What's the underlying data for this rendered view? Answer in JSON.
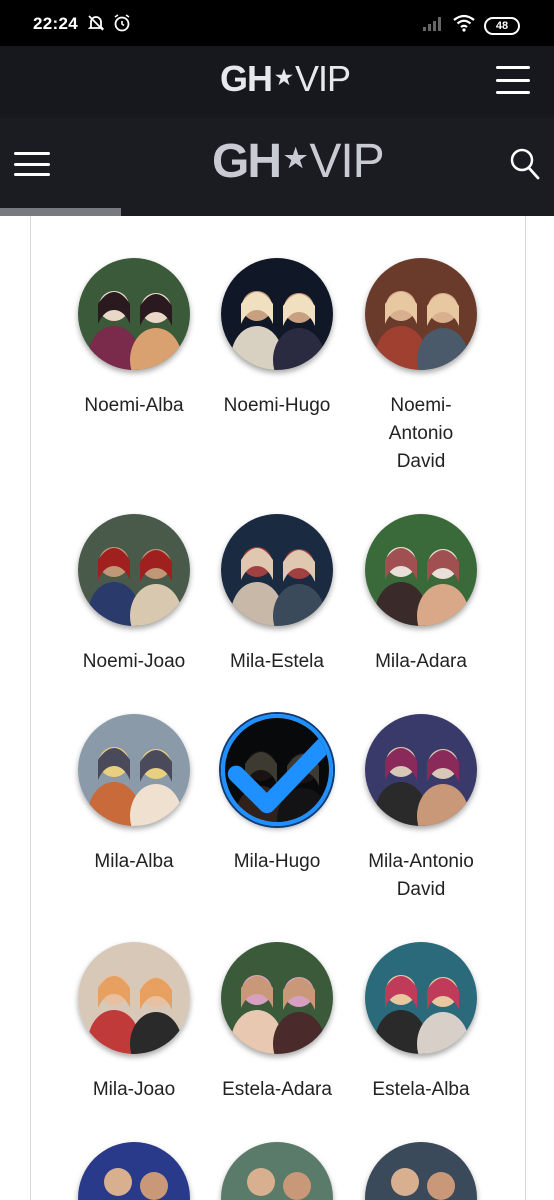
{
  "status": {
    "time": "22:24",
    "battery": "48",
    "icons": [
      "bell-off-icon",
      "alarm-icon",
      "signal-icon",
      "wifi-icon",
      "battery-icon"
    ]
  },
  "header": {
    "logo_gh": "GH",
    "logo_star": "★",
    "logo_vip": "VIP"
  },
  "colors": {
    "topbar": "#16181d",
    "navbar": "#1a1c22",
    "selected": "#1e90ff"
  },
  "couples": [
    {
      "label": "Noemi-Alba",
      "selected": false
    },
    {
      "label": "Noemi-Hugo",
      "selected": false
    },
    {
      "label": "Noemi-Antonio David",
      "label_lines": [
        "Noemi-",
        "Antonio",
        "David"
      ],
      "selected": false
    },
    {
      "label": "Noemi-Joao",
      "selected": false
    },
    {
      "label": "Mila-Estela",
      "selected": false
    },
    {
      "label": "Mila-Adara",
      "selected": false
    },
    {
      "label": "Mila-Alba",
      "selected": false
    },
    {
      "label": "Mila-Hugo",
      "selected": true
    },
    {
      "label": "Mila-Antonio David",
      "label_lines": [
        "Mila-Antonio",
        "David"
      ],
      "selected": false
    },
    {
      "label": "Mila-Joao",
      "selected": false
    },
    {
      "label": "Estela-Adara",
      "selected": false
    },
    {
      "label": "Estela-Alba",
      "selected": false
    }
  ]
}
